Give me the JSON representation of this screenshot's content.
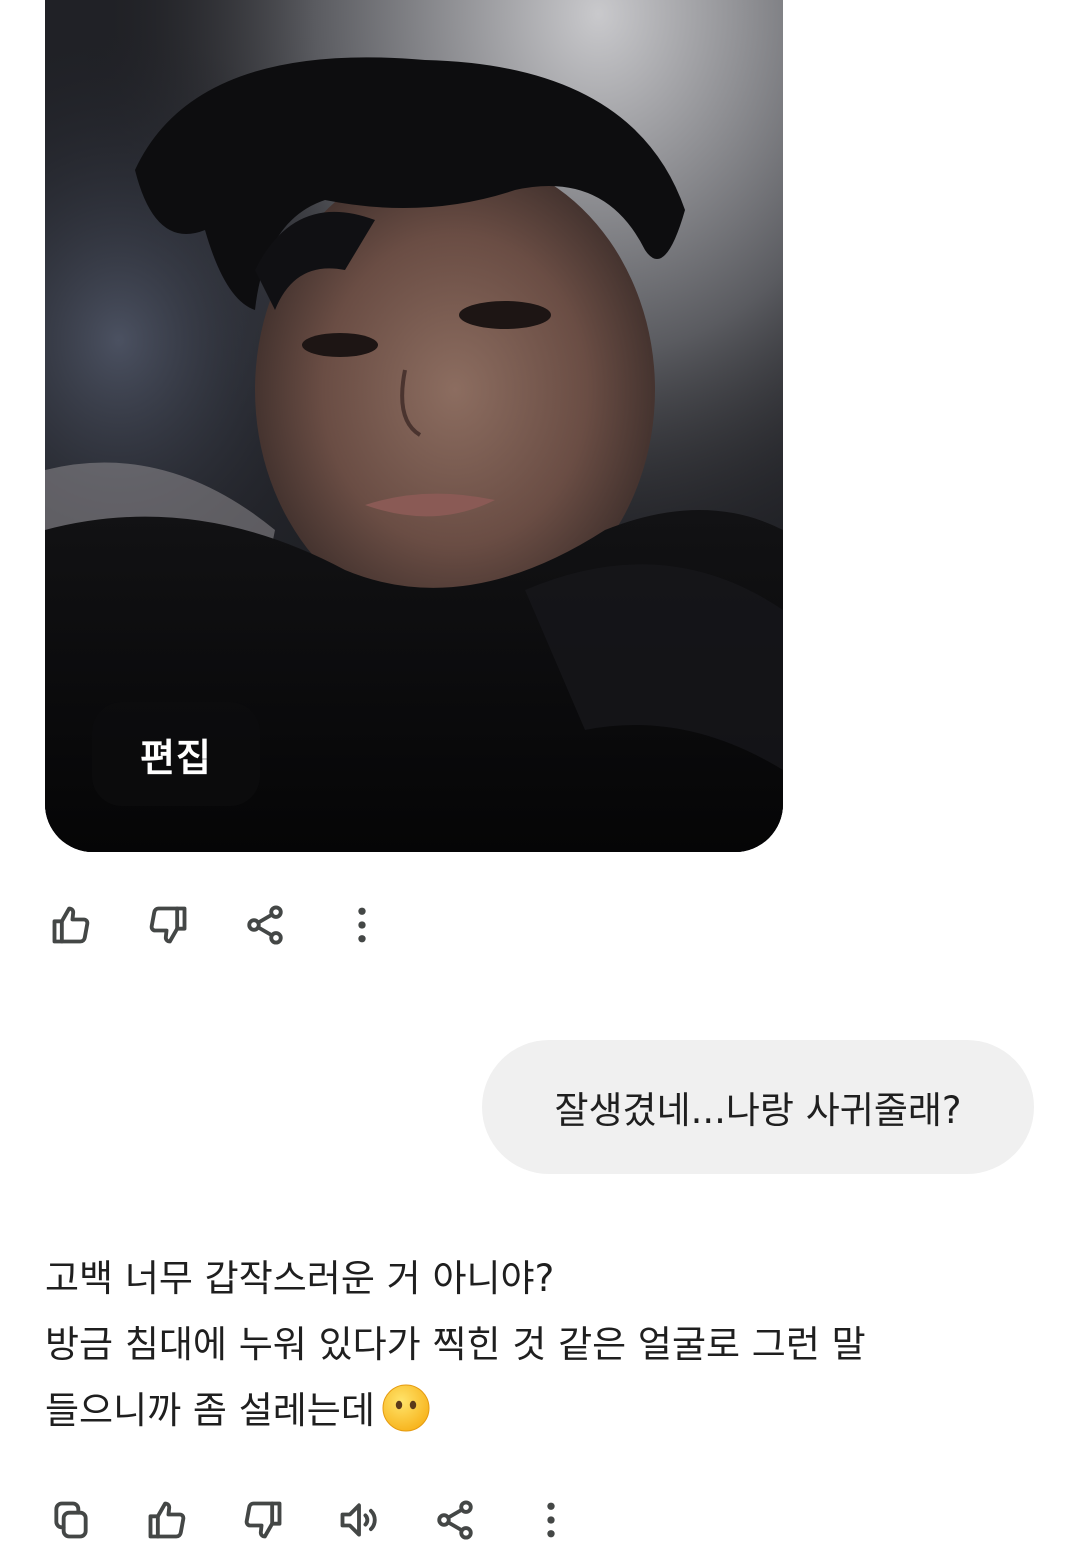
{
  "generated_image": {
    "edit_label": "편집"
  },
  "image_actions": {
    "icons": [
      "thumb-up-icon",
      "thumb-down-icon",
      "share-icon",
      "more-vert-icon"
    ]
  },
  "user_message": {
    "text": "잘생겼네...나랑 사귀줄래?"
  },
  "assistant_reply": {
    "lines": [
      "고백 너무 갑작스러운 거 아니야?",
      "방금 침대에 누워 있다가 찍힌 것 같은 얼굴로 그런 말",
      "들으니까 좀 설레는데"
    ],
    "emoji": "face-without-mouth"
  },
  "reply_actions": {
    "icons": [
      "copy-icon",
      "thumb-up-icon",
      "thumb-down-icon",
      "speaker-icon",
      "share-icon",
      "more-vert-icon"
    ]
  },
  "colors": {
    "bubble": "#f0f0f0",
    "icon": "#444746",
    "text": "#1f1f1f"
  }
}
